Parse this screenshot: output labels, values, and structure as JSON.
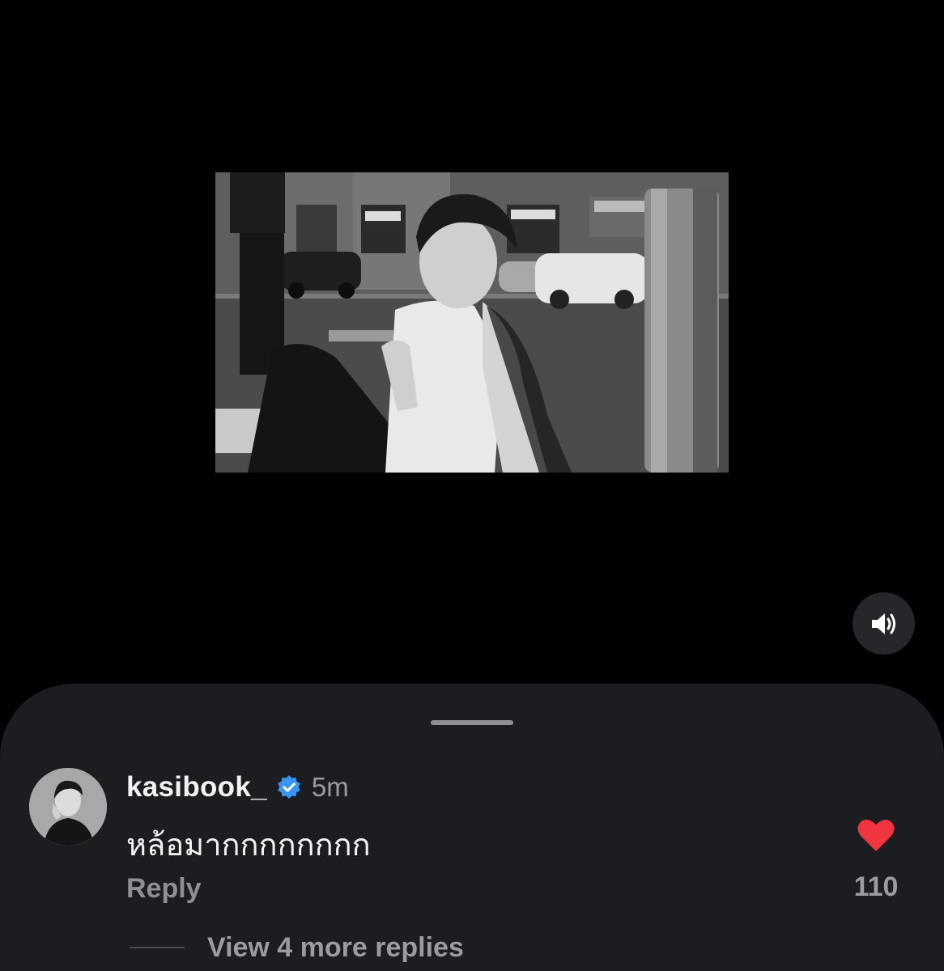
{
  "media": {
    "sound_icon": "speaker-sound-on-icon"
  },
  "comment": {
    "avatar_icon": "user-avatar-photo",
    "username": "kasibook_",
    "verified_icon": "verified-badge-icon",
    "time": "5m",
    "text": "หล้อมากกกกกกกก",
    "reply_label": "Reply",
    "like_icon": "heart-filled-icon",
    "like_count": "110",
    "more_replies": "View 4 more replies"
  },
  "colors": {
    "sheet_bg": "#1b1d21",
    "heart": "#f0353e",
    "verified": "#3797f0"
  }
}
